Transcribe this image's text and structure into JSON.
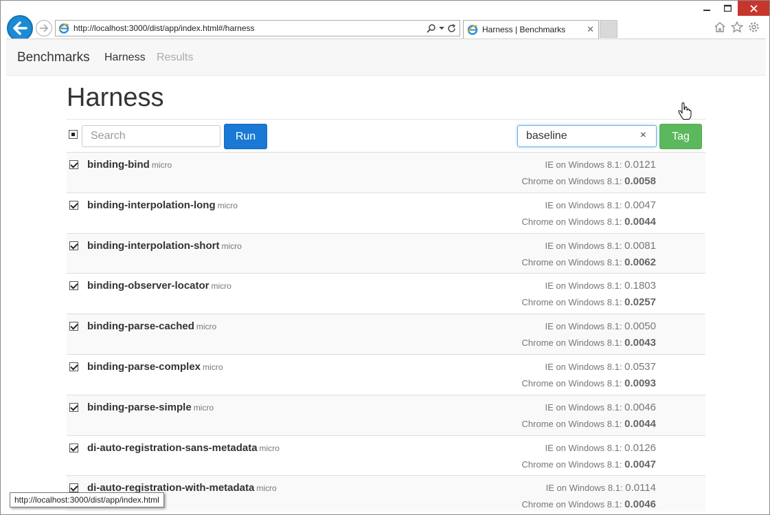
{
  "browser": {
    "url": "http://localhost:3000/dist/app/index.html#/harness",
    "tab_title": "Harness | Benchmarks",
    "status_url": "http://localhost:3000/dist/app/index.html",
    "accent": "#1c8bd6"
  },
  "navbar": {
    "brand": "Benchmarks",
    "harness": "Harness",
    "results": "Results"
  },
  "page": {
    "title": "Harness"
  },
  "toolbar": {
    "search_placeholder": "Search",
    "run_label": "Run",
    "tag_value": "baseline",
    "tag_clear": "×",
    "tag_label": "Tag",
    "run_color": "#1979d4",
    "tag_color": "#5cb85c"
  },
  "rows": [
    {
      "name": "binding-bind",
      "kind": "micro",
      "ie_label": "IE on Windows 8.1: ",
      "ie_value": "0.0121",
      "chrome_label": "Chrome on Windows 8.1: ",
      "chrome_value": "0.0058"
    },
    {
      "name": "binding-interpolation-long",
      "kind": "micro",
      "ie_label": "IE on Windows 8.1: ",
      "ie_value": "0.0047",
      "chrome_label": "Chrome on Windows 8.1: ",
      "chrome_value": "0.0044"
    },
    {
      "name": "binding-interpolation-short",
      "kind": "micro",
      "ie_label": "IE on Windows 8.1: ",
      "ie_value": "0.0081",
      "chrome_label": "Chrome on Windows 8.1: ",
      "chrome_value": "0.0062"
    },
    {
      "name": "binding-observer-locator",
      "kind": "micro",
      "ie_label": "IE on Windows 8.1: ",
      "ie_value": "0.1803",
      "chrome_label": "Chrome on Windows 8.1: ",
      "chrome_value": "0.0257"
    },
    {
      "name": "binding-parse-cached",
      "kind": "micro",
      "ie_label": "IE on Windows 8.1: ",
      "ie_value": "0.0050",
      "chrome_label": "Chrome on Windows 8.1: ",
      "chrome_value": "0.0043"
    },
    {
      "name": "binding-parse-complex",
      "kind": "micro",
      "ie_label": "IE on Windows 8.1: ",
      "ie_value": "0.0537",
      "chrome_label": "Chrome on Windows 8.1: ",
      "chrome_value": "0.0093"
    },
    {
      "name": "binding-parse-simple",
      "kind": "micro",
      "ie_label": "IE on Windows 8.1: ",
      "ie_value": "0.0046",
      "chrome_label": "Chrome on Windows 8.1: ",
      "chrome_value": "0.0044"
    },
    {
      "name": "di-auto-registration-sans-metadata",
      "kind": "micro",
      "ie_label": "IE on Windows 8.1: ",
      "ie_value": "0.0126",
      "chrome_label": "Chrome on Windows 8.1: ",
      "chrome_value": "0.0047"
    },
    {
      "name": "di-auto-registration-with-metadata",
      "kind": "micro",
      "ie_label": "IE on Windows 8.1: ",
      "ie_value": "0.0114",
      "chrome_label": "Chrome on Windows 8.1: ",
      "chrome_value": "0.0046"
    }
  ]
}
